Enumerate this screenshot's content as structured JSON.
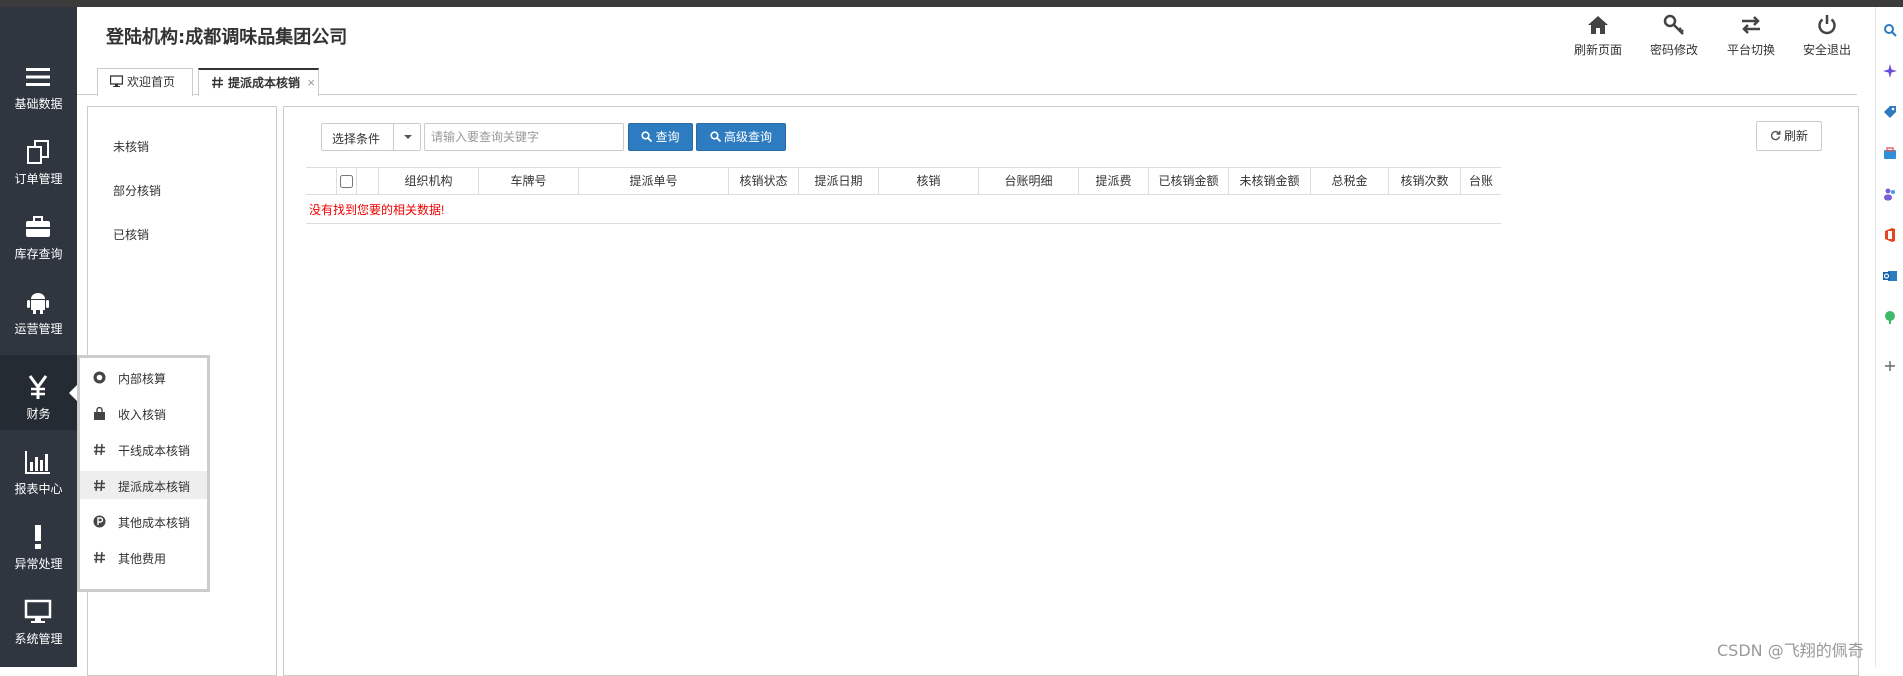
{
  "colors": {
    "sidebar_bg": "#2f3640",
    "primary_blue": "#2d7bc0",
    "error_red": "#ee0000"
  },
  "sidebar": {
    "items": [
      {
        "label": "基础数据",
        "icon": "menu-bars-icon"
      },
      {
        "label": "订单管理",
        "icon": "copy-icon"
      },
      {
        "label": "库存查询",
        "icon": "briefcase-icon"
      },
      {
        "label": "运营管理",
        "icon": "android-icon"
      },
      {
        "label": "财务",
        "icon": "yen-icon"
      },
      {
        "label": "报表中心",
        "icon": "bar-chart-icon"
      },
      {
        "label": "异常处理",
        "icon": "exclamation-icon"
      },
      {
        "label": "系统管理",
        "icon": "monitor-icon"
      }
    ]
  },
  "header": {
    "title": "登陆机构:成都调味品集团公司",
    "actions": [
      {
        "label": "刷新页面",
        "icon": "home-icon"
      },
      {
        "label": "密码修改",
        "icon": "key-icon"
      },
      {
        "label": "平台切换",
        "icon": "exchange-icon"
      },
      {
        "label": "安全退出",
        "icon": "power-icon"
      }
    ]
  },
  "tabs": [
    {
      "label": "欢迎首页",
      "icon": "desktop-icon"
    },
    {
      "label": "提派成本核销",
      "icon": "hash-icon",
      "close": "×"
    }
  ],
  "left_panel": {
    "items": [
      "未核销",
      "部分核销",
      "已核销"
    ]
  },
  "toolbar": {
    "select_label": "选择条件",
    "search_placeholder": "请输入要查询关键字",
    "query_label": "查询",
    "advanced_query_label": "高级查询",
    "refresh_label": "刷新"
  },
  "table": {
    "columns": [
      "组织机构",
      "车牌号",
      "提派单号",
      "核销状态",
      "提派日期",
      "核销",
      "台账明细",
      "提派费",
      "已核销金额",
      "未核销金额",
      "总税金",
      "核销次数",
      "台账"
    ],
    "empty_message": "没有找到您要的相关数据!"
  },
  "finance_menu": {
    "items": [
      {
        "label": "内部核算",
        "icon": "circle-o-icon"
      },
      {
        "label": "收入核销",
        "icon": "shopping-bag-icon"
      },
      {
        "label": "干线成本核销",
        "icon": "hash-icon"
      },
      {
        "label": "提派成本核销",
        "icon": "hash-icon"
      },
      {
        "label": "其他成本核销",
        "icon": "p-circle-icon"
      },
      {
        "label": "其他费用",
        "icon": "hash-icon"
      }
    ]
  },
  "watermark": "CSDN @飞翔的佩奇"
}
